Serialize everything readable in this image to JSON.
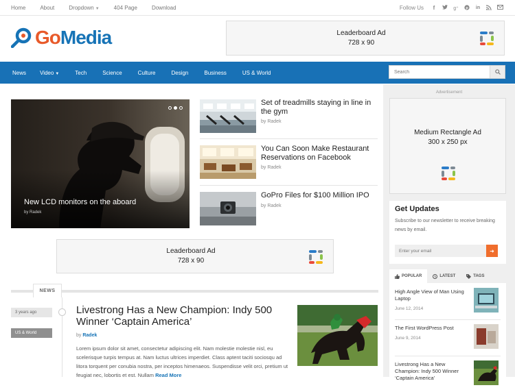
{
  "topnav": {
    "items": [
      "Home",
      "About",
      "Dropdown",
      "404 Page",
      "Download"
    ],
    "follow_label": "Follow Us"
  },
  "social_icons": [
    "facebook-icon",
    "twitter-icon",
    "google-plus-icon",
    "pinterest-icon",
    "linkedin-icon",
    "rss-icon",
    "email-icon"
  ],
  "logo": {
    "part1": "Go",
    "part2": "Media"
  },
  "header_ad": {
    "line1": "Leaderboard Ad",
    "line2": "728 x 90"
  },
  "mainnav": {
    "items": [
      "News",
      "Video",
      "Tech",
      "Science",
      "Culture",
      "Design",
      "Business",
      "US & World"
    ]
  },
  "search": {
    "placeholder": "Search"
  },
  "featured": {
    "title": "New LCD monitors on the aboard",
    "author": "by Radek"
  },
  "side_posts": [
    {
      "title": "Set of treadmills staying in line in the gym",
      "author": "by Radek"
    },
    {
      "title": "You Can Soon Make Restaurant Reservations on Facebook",
      "author": "by Radek"
    },
    {
      "title": "GoPro Files for $100 Million IPO",
      "author": "by Radek"
    }
  ],
  "content_ad": {
    "line1": "Leaderboard Ad",
    "line2": "728 x 90"
  },
  "news_section": {
    "tag": "NEWS"
  },
  "article": {
    "time_ago": "3 years ago",
    "category": "US & World",
    "title": "Livestrong Has a New Champion: Indy 500 Winner ‘Captain America’",
    "by_prefix": "by",
    "author": "Radek",
    "excerpt": "Lorem ipsum dolor sit amet, consectetur adipiscing elit. Nam molestie molestie nisl, eu scelerisque turpis tempus at. Nam luctus ultrices imperdiet. Class aptent taciti sociosqu ad litora torquent per conubia nostra, per inceptos himenaeos. Suspendisse velit orci, pretium ut feugiat nec, lobortis et est. Nullam",
    "read_more": "Read More"
  },
  "sidebar": {
    "ad_label": "Advertisement",
    "rect_ad": {
      "line1": "Medium Rectangle Ad",
      "line2": "300 x 250 px"
    },
    "updates": {
      "title": "Get Updates",
      "text": "Subscribe to our newsletter to receive breaking news by email.",
      "placeholder": "Enter your email"
    },
    "tabs": [
      "POPULAR",
      "LATEST",
      "TAGS"
    ],
    "popular": [
      {
        "title": "High Angle View of Man Using Laptop",
        "date": "June 12, 2014"
      },
      {
        "title": "The First WordPress Post",
        "date": "June 9, 2014"
      },
      {
        "title": "Livestrong Has a New Champion: Indy 500 Winner ‘Captain America’",
        "date": ""
      }
    ]
  },
  "colors": {
    "brand_blue": "#1871b6",
    "brand_orange": "#e85a2a",
    "button_orange": "#f06e2d"
  }
}
